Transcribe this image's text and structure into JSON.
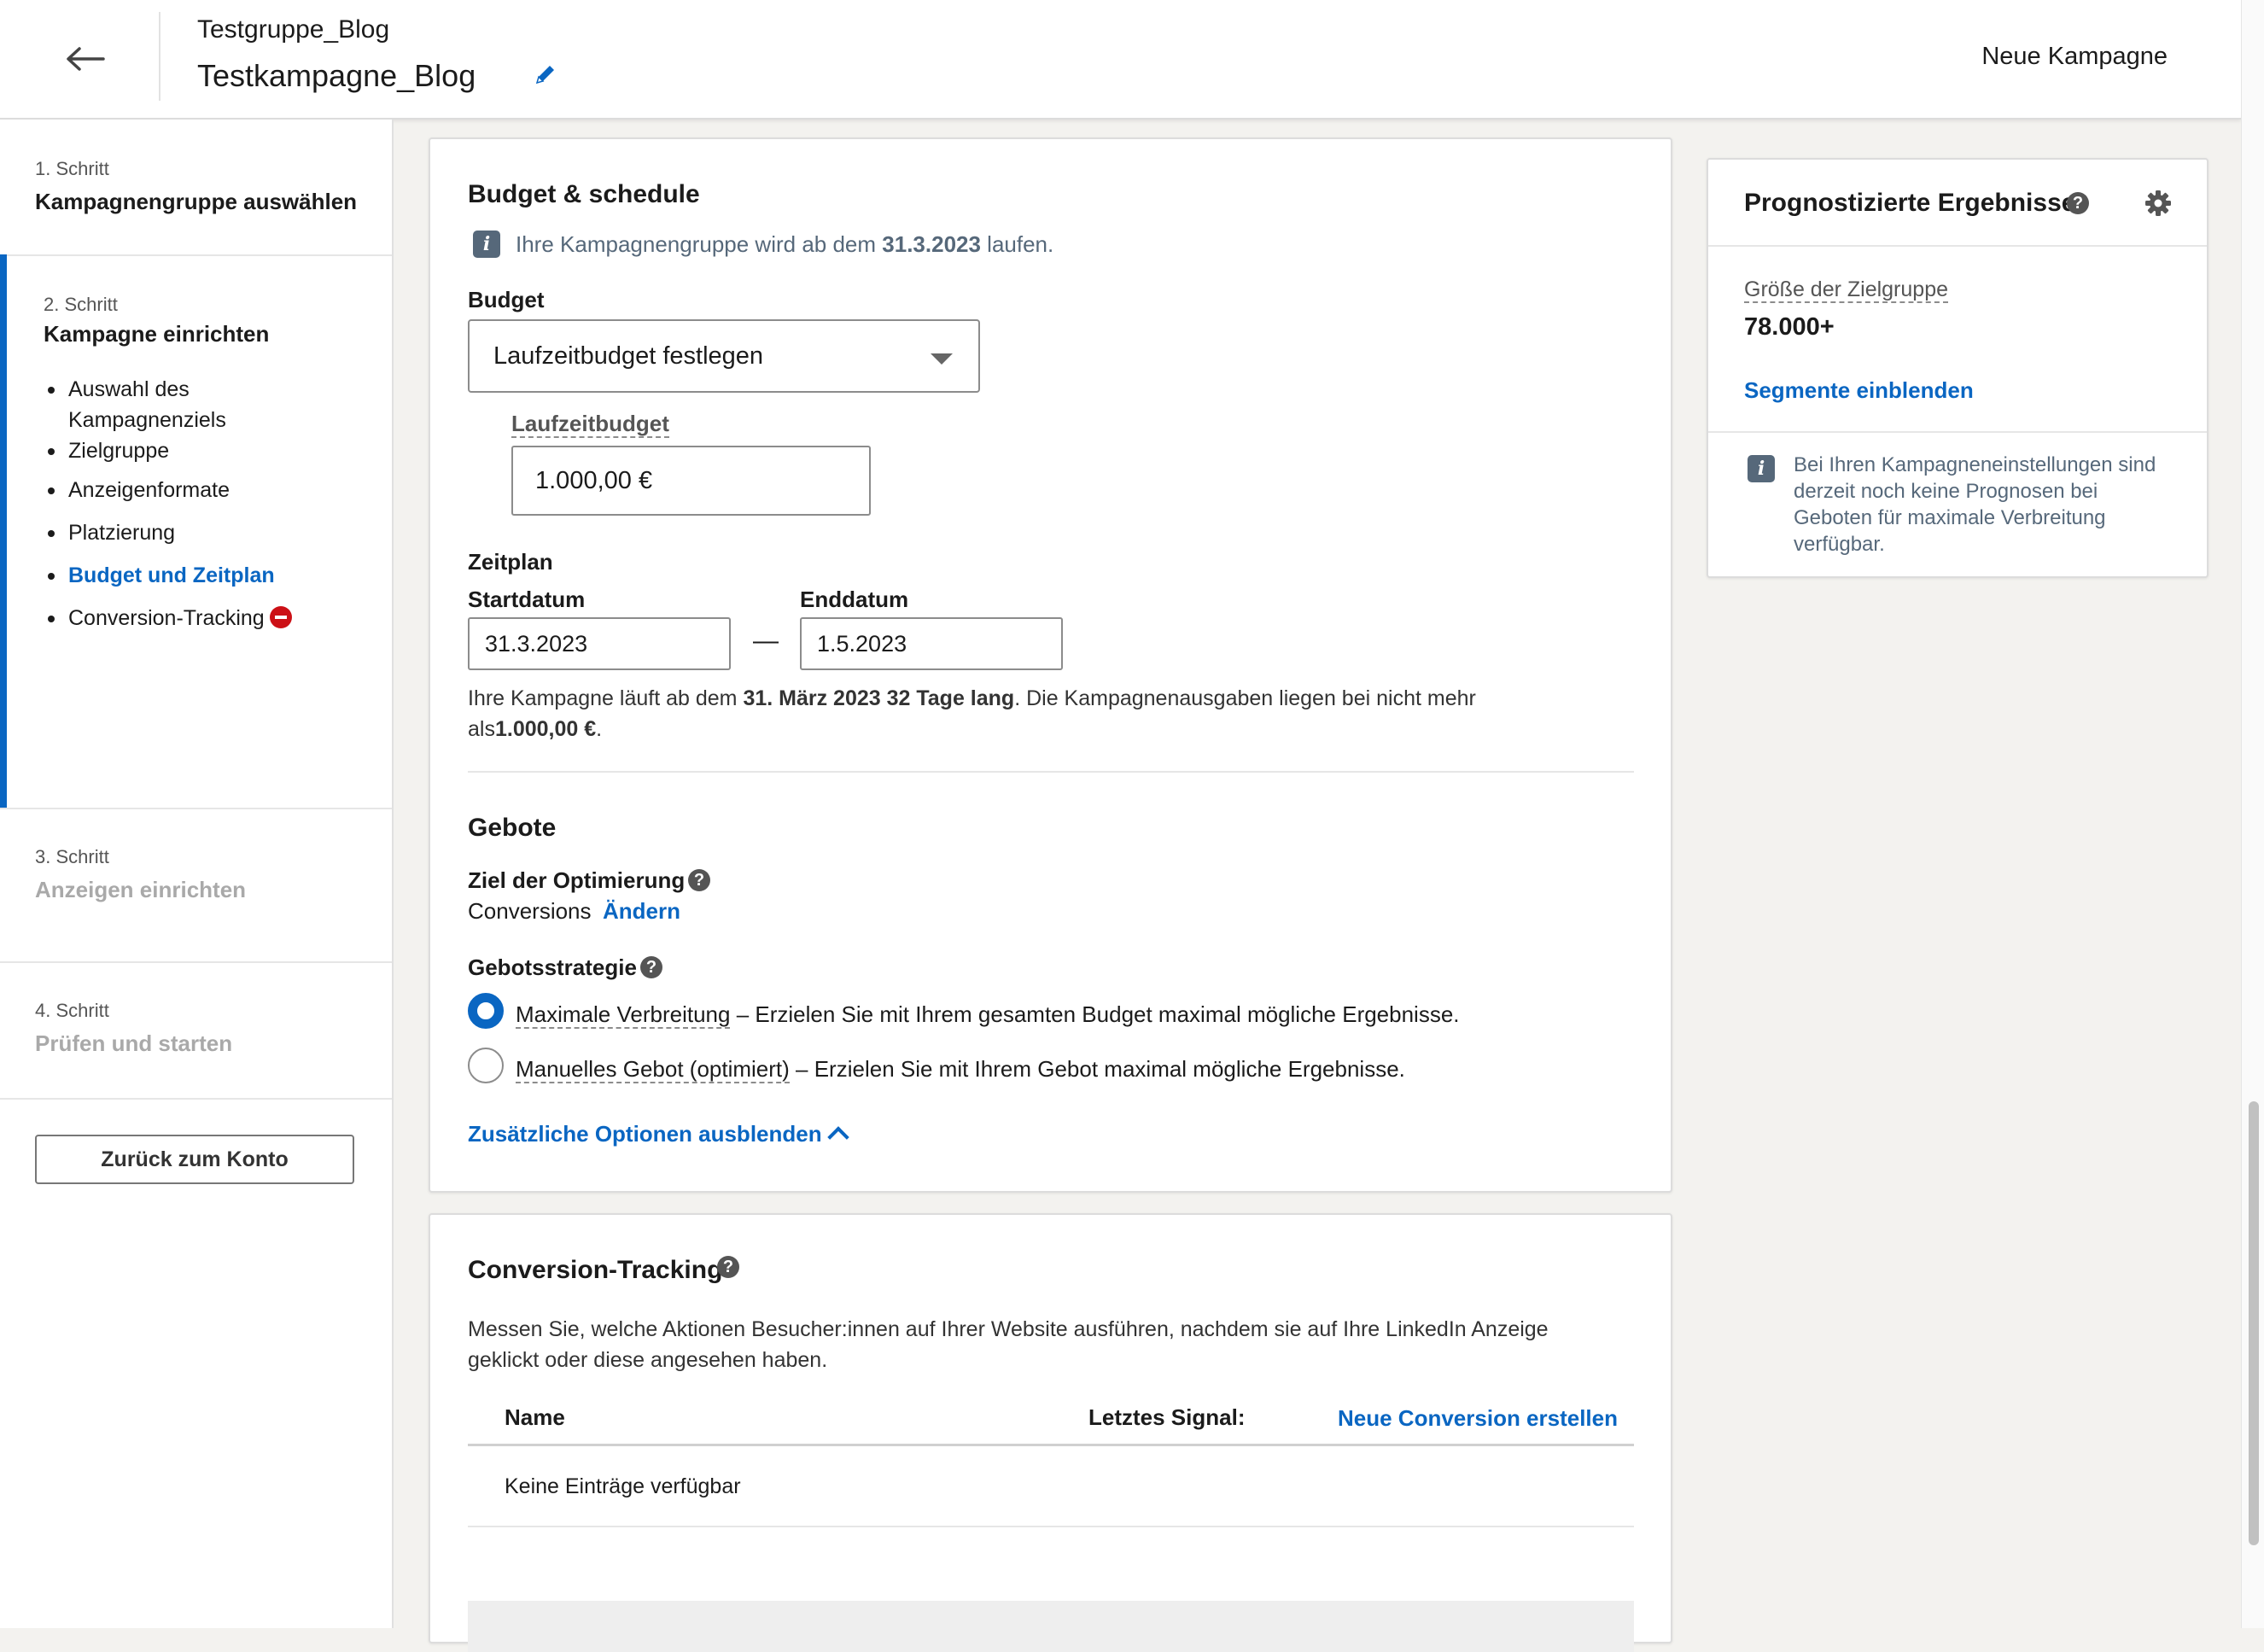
{
  "header": {
    "group_name": "Testgruppe_Blog",
    "campaign_name": "Testkampagne_Blog",
    "new_campaign": "Neue Kampagne"
  },
  "sidebar": {
    "step1": {
      "num": "1. Schritt",
      "title": "Kampagnengruppe auswählen"
    },
    "step2": {
      "num": "2. Schritt",
      "title": "Kampagne einrichten",
      "items": [
        {
          "label": "Auswahl des Kampagnenziels"
        },
        {
          "label": "Zielgruppe"
        },
        {
          "label": "Anzeigenformate"
        },
        {
          "label": "Platzierung"
        },
        {
          "label": "Budget und Zeitplan"
        },
        {
          "label": "Conversion-Tracking"
        }
      ]
    },
    "step3": {
      "num": "3. Schritt",
      "title": "Anzeigen einrichten"
    },
    "step4": {
      "num": "4. Schritt",
      "title": "Prüfen und starten"
    },
    "back_button": "Zurück zum Konto"
  },
  "budget": {
    "title": "Budget & schedule",
    "info_prefix": "Ihre Kampagnengruppe wird ab dem ",
    "info_date": "31.3.2023",
    "info_suffix": " laufen.",
    "budget_label": "Budget",
    "budget_type": "Laufzeitbudget festlegen",
    "lifetime_label": "Laufzeitbudget",
    "lifetime_value": "1.000,00 €",
    "schedule_label": "Zeitplan",
    "start_label": "Startdatum",
    "start_value": "31.3.2023",
    "dash": "—",
    "end_label": "Enddatum",
    "end_value": "1.5.2023",
    "summary_1": "Ihre Kampagne läuft ab dem ",
    "summary_bold1": "31. März 2023 32 Tage lang",
    "summary_2": ". Die Kampagnenausgaben liegen bei nicht mehr als",
    "summary_bold2": "1.000,00 €",
    "summary_3": "."
  },
  "bids": {
    "title": "Gebote",
    "goal_label": "Ziel der Optimierung",
    "goal_value": "Conversions",
    "change_link": "Ändern",
    "strategy_label": "Gebotsstrategie",
    "option1_name": "Maximale Verbreitung",
    "option1_desc": " – Erzielen Sie mit Ihrem gesamten Budget maximal mögliche Ergebnisse.",
    "option2_name": "Manuelles Gebot (optimiert)",
    "option2_desc": " – Erzielen Sie mit Ihrem Gebot maximal mögliche Ergebnisse.",
    "more_options": "Zusätzliche Optionen ausblenden"
  },
  "conversion": {
    "title": "Conversion-Tracking",
    "description": "Messen Sie, welche Aktionen Besucher:innen auf Ihrer Website ausführen, nachdem sie auf Ihre LinkedIn Anzeige geklickt oder diese angesehen haben.",
    "col_name": "Name",
    "col_signal": "Letztes Signal:",
    "new_link": "Neue Conversion erstellen",
    "empty": "Keine Einträge verfügbar"
  },
  "forecast": {
    "title": "Prognostizierte Ergebnisse",
    "audience_label": "Größe der Zielgruppe",
    "audience_value": "78.000+",
    "segments_link": "Segmente einblenden",
    "info": "Bei Ihren Kampagneneinstellungen sind derzeit noch keine Prognosen bei Geboten für maximale Verbreitung verfügbar."
  },
  "colors": {
    "accent": "#0a66c2",
    "error": "#cc1016",
    "info_icon": "#56687a"
  },
  "icons": [
    "arrow-left-icon",
    "pencil-icon",
    "info-icon",
    "help-icon",
    "gear-icon",
    "blocked-icon",
    "chevron-up-icon",
    "caret-down-icon"
  ]
}
